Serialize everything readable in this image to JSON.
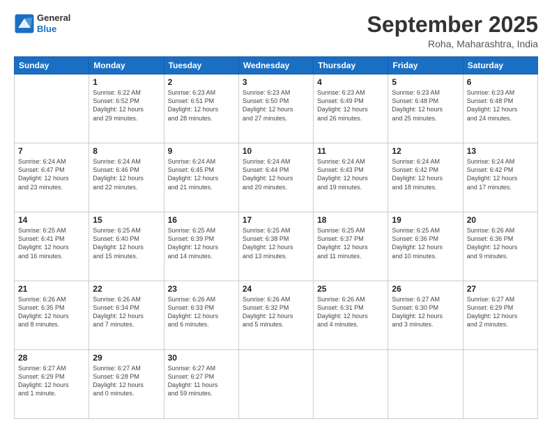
{
  "header": {
    "logo_general": "General",
    "logo_blue": "Blue",
    "month_title": "September 2025",
    "location": "Roha, Maharashtra, India"
  },
  "days_of_week": [
    "Sunday",
    "Monday",
    "Tuesday",
    "Wednesday",
    "Thursday",
    "Friday",
    "Saturday"
  ],
  "weeks": [
    [
      {
        "day": "",
        "info": ""
      },
      {
        "day": "1",
        "info": "Sunrise: 6:22 AM\nSunset: 6:52 PM\nDaylight: 12 hours\nand 29 minutes."
      },
      {
        "day": "2",
        "info": "Sunrise: 6:23 AM\nSunset: 6:51 PM\nDaylight: 12 hours\nand 28 minutes."
      },
      {
        "day": "3",
        "info": "Sunrise: 6:23 AM\nSunset: 6:50 PM\nDaylight: 12 hours\nand 27 minutes."
      },
      {
        "day": "4",
        "info": "Sunrise: 6:23 AM\nSunset: 6:49 PM\nDaylight: 12 hours\nand 26 minutes."
      },
      {
        "day": "5",
        "info": "Sunrise: 6:23 AM\nSunset: 6:48 PM\nDaylight: 12 hours\nand 25 minutes."
      },
      {
        "day": "6",
        "info": "Sunrise: 6:23 AM\nSunset: 6:48 PM\nDaylight: 12 hours\nand 24 minutes."
      }
    ],
    [
      {
        "day": "7",
        "info": "Sunrise: 6:24 AM\nSunset: 6:47 PM\nDaylight: 12 hours\nand 23 minutes."
      },
      {
        "day": "8",
        "info": "Sunrise: 6:24 AM\nSunset: 6:46 PM\nDaylight: 12 hours\nand 22 minutes."
      },
      {
        "day": "9",
        "info": "Sunrise: 6:24 AM\nSunset: 6:45 PM\nDaylight: 12 hours\nand 21 minutes."
      },
      {
        "day": "10",
        "info": "Sunrise: 6:24 AM\nSunset: 6:44 PM\nDaylight: 12 hours\nand 20 minutes."
      },
      {
        "day": "11",
        "info": "Sunrise: 6:24 AM\nSunset: 6:43 PM\nDaylight: 12 hours\nand 19 minutes."
      },
      {
        "day": "12",
        "info": "Sunrise: 6:24 AM\nSunset: 6:42 PM\nDaylight: 12 hours\nand 18 minutes."
      },
      {
        "day": "13",
        "info": "Sunrise: 6:24 AM\nSunset: 6:42 PM\nDaylight: 12 hours\nand 17 minutes."
      }
    ],
    [
      {
        "day": "14",
        "info": "Sunrise: 6:25 AM\nSunset: 6:41 PM\nDaylight: 12 hours\nand 16 minutes."
      },
      {
        "day": "15",
        "info": "Sunrise: 6:25 AM\nSunset: 6:40 PM\nDaylight: 12 hours\nand 15 minutes."
      },
      {
        "day": "16",
        "info": "Sunrise: 6:25 AM\nSunset: 6:39 PM\nDaylight: 12 hours\nand 14 minutes."
      },
      {
        "day": "17",
        "info": "Sunrise: 6:25 AM\nSunset: 6:38 PM\nDaylight: 12 hours\nand 13 minutes."
      },
      {
        "day": "18",
        "info": "Sunrise: 6:25 AM\nSunset: 6:37 PM\nDaylight: 12 hours\nand 11 minutes."
      },
      {
        "day": "19",
        "info": "Sunrise: 6:25 AM\nSunset: 6:36 PM\nDaylight: 12 hours\nand 10 minutes."
      },
      {
        "day": "20",
        "info": "Sunrise: 6:26 AM\nSunset: 6:36 PM\nDaylight: 12 hours\nand 9 minutes."
      }
    ],
    [
      {
        "day": "21",
        "info": "Sunrise: 6:26 AM\nSunset: 6:35 PM\nDaylight: 12 hours\nand 8 minutes."
      },
      {
        "day": "22",
        "info": "Sunrise: 6:26 AM\nSunset: 6:34 PM\nDaylight: 12 hours\nand 7 minutes."
      },
      {
        "day": "23",
        "info": "Sunrise: 6:26 AM\nSunset: 6:33 PM\nDaylight: 12 hours\nand 6 minutes."
      },
      {
        "day": "24",
        "info": "Sunrise: 6:26 AM\nSunset: 6:32 PM\nDaylight: 12 hours\nand 5 minutes."
      },
      {
        "day": "25",
        "info": "Sunrise: 6:26 AM\nSunset: 6:31 PM\nDaylight: 12 hours\nand 4 minutes."
      },
      {
        "day": "26",
        "info": "Sunrise: 6:27 AM\nSunset: 6:30 PM\nDaylight: 12 hours\nand 3 minutes."
      },
      {
        "day": "27",
        "info": "Sunrise: 6:27 AM\nSunset: 6:29 PM\nDaylight: 12 hours\nand 2 minutes."
      }
    ],
    [
      {
        "day": "28",
        "info": "Sunrise: 6:27 AM\nSunset: 6:29 PM\nDaylight: 12 hours\nand 1 minute."
      },
      {
        "day": "29",
        "info": "Sunrise: 6:27 AM\nSunset: 6:28 PM\nDaylight: 12 hours\nand 0 minutes."
      },
      {
        "day": "30",
        "info": "Sunrise: 6:27 AM\nSunset: 6:27 PM\nDaylight: 11 hours\nand 59 minutes."
      },
      {
        "day": "",
        "info": ""
      },
      {
        "day": "",
        "info": ""
      },
      {
        "day": "",
        "info": ""
      },
      {
        "day": "",
        "info": ""
      }
    ]
  ]
}
